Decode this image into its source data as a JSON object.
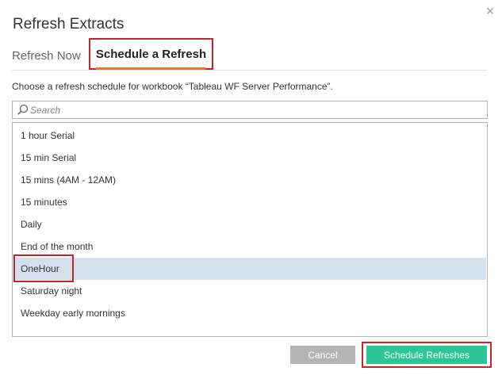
{
  "dialog": {
    "title": "Refresh Extracts",
    "close_glyph": "×"
  },
  "tabs": [
    {
      "label": "Refresh Now",
      "active": false
    },
    {
      "label": "Schedule a Refresh",
      "active": true
    }
  ],
  "description": "Choose a refresh schedule for workbook “Tableau WF Server Performance”.",
  "search": {
    "placeholder": "Search",
    "value": ""
  },
  "schedules": [
    {
      "label": "1 hour Serial",
      "selected": false
    },
    {
      "label": "15 min Serial",
      "selected": false
    },
    {
      "label": "15 mins (4AM - 12AM)",
      "selected": false
    },
    {
      "label": "15 minutes",
      "selected": false
    },
    {
      "label": "Daily",
      "selected": false
    },
    {
      "label": "End of the month",
      "selected": false
    },
    {
      "label": "OneHour",
      "selected": true
    },
    {
      "label": "Saturday night",
      "selected": false
    },
    {
      "label": "Weekday early mornings",
      "selected": false
    }
  ],
  "buttons": {
    "cancel": "Cancel",
    "schedule": "Schedule Refreshes"
  },
  "colors": {
    "accent_underline": "#e8762d",
    "primary_button": "#2dc597",
    "secondary_button": "#b4b4b4",
    "selected_row": "#d4e0ec",
    "annotation_box": "#c0272d"
  },
  "icons": {
    "search": "search-icon",
    "close": "close-icon"
  }
}
